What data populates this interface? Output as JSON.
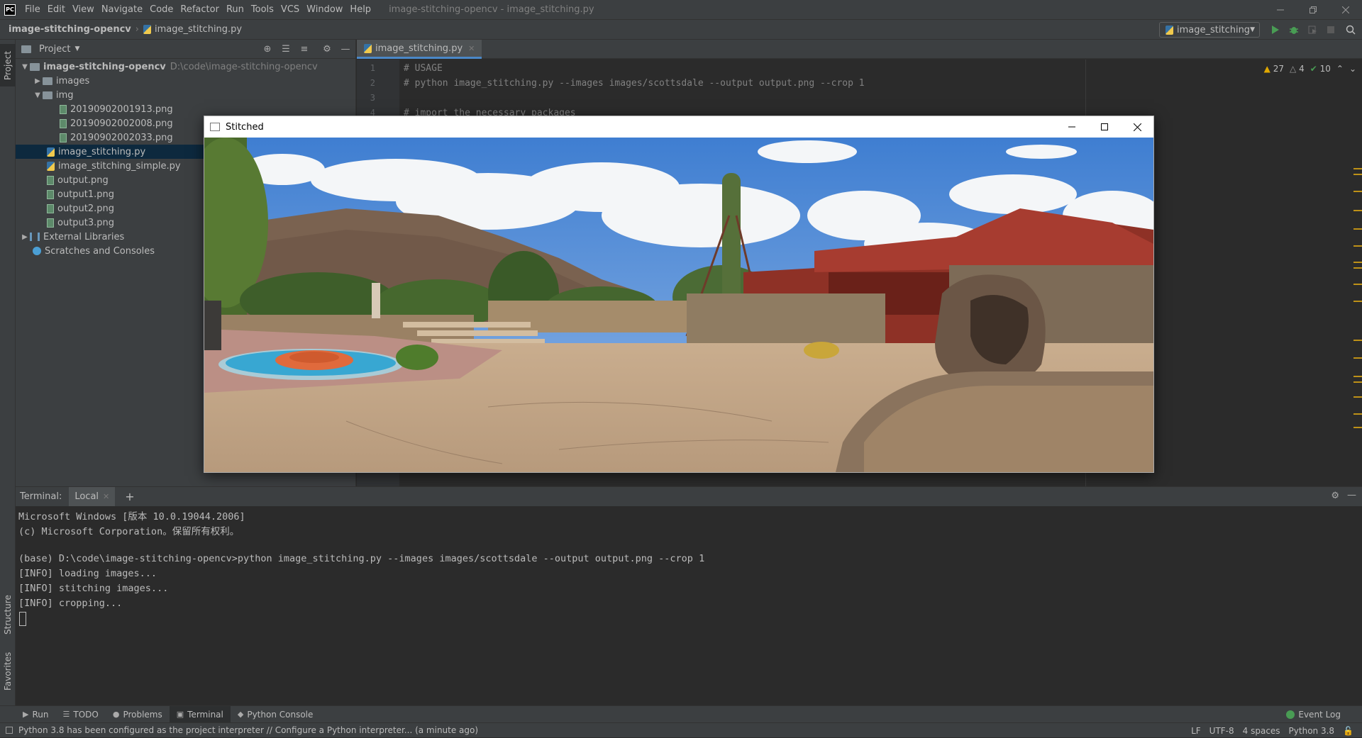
{
  "app": {
    "logo": "PC",
    "menu": [
      "File",
      "Edit",
      "View",
      "Navigate",
      "Code",
      "Refactor",
      "Run",
      "Tools",
      "VCS",
      "Window",
      "Help"
    ],
    "window_title": "image-stitching-opencv - image_stitching.py"
  },
  "navbar": {
    "project": "image-stitching-opencv",
    "file": "image_stitching.py",
    "run_config": "image_stitching"
  },
  "left_stripe": {
    "project": "Project",
    "structure": "Structure",
    "favorites": "Favorites"
  },
  "project_panel": {
    "title": "Project",
    "tree": [
      {
        "label": "image-stitching-opencv",
        "hint": "D:\\code\\image-stitching-opencv"
      },
      {
        "label": "images"
      },
      {
        "label": "img"
      },
      {
        "label": "20190902001913.png"
      },
      {
        "label": "20190902002008.png"
      },
      {
        "label": "20190902002033.png"
      },
      {
        "label": "image_stitching.py"
      },
      {
        "label": "image_stitching_simple.py"
      },
      {
        "label": "output.png"
      },
      {
        "label": "output1.png"
      },
      {
        "label": "output2.png"
      },
      {
        "label": "output3.png"
      },
      {
        "label": "External Libraries"
      },
      {
        "label": "Scratches and Consoles"
      }
    ]
  },
  "editor": {
    "tab": "image_stitching.py",
    "line_numbers": [
      "1",
      "2",
      "3",
      "4"
    ],
    "lines": [
      "# USAGE",
      "# python image_stitching.py --images images/scottsdale --output output.png --crop 1",
      "",
      "# import the necessary packages"
    ],
    "inspections": {
      "warnings": "27",
      "weak": "4",
      "ok": "10"
    }
  },
  "stitched_window": {
    "title": "Stitched"
  },
  "terminal": {
    "label": "Terminal:",
    "tab": "Local",
    "lines": [
      "Microsoft Windows [版本 10.0.19044.2006]",
      "(c) Microsoft Corporation。保留所有权利。",
      "",
      "(base) D:\\code\\image-stitching-opencv>python image_stitching.py --images images/scottsdale --output output.png --crop 1",
      "[INFO] loading images...",
      "[INFO] stitching images...",
      "[INFO] cropping..."
    ]
  },
  "bottom_tabs": [
    "Run",
    "TODO",
    "Problems",
    "Terminal",
    "Python Console"
  ],
  "event_log": "Event Log",
  "status_bar": {
    "message": "Python 3.8 has been configured as the project interpreter // Configure a Python interpreter... (a minute ago)",
    "line_sep": "LF",
    "encoding": "UTF-8",
    "indent": "4 spaces",
    "interpreter": "Python 3.8"
  }
}
